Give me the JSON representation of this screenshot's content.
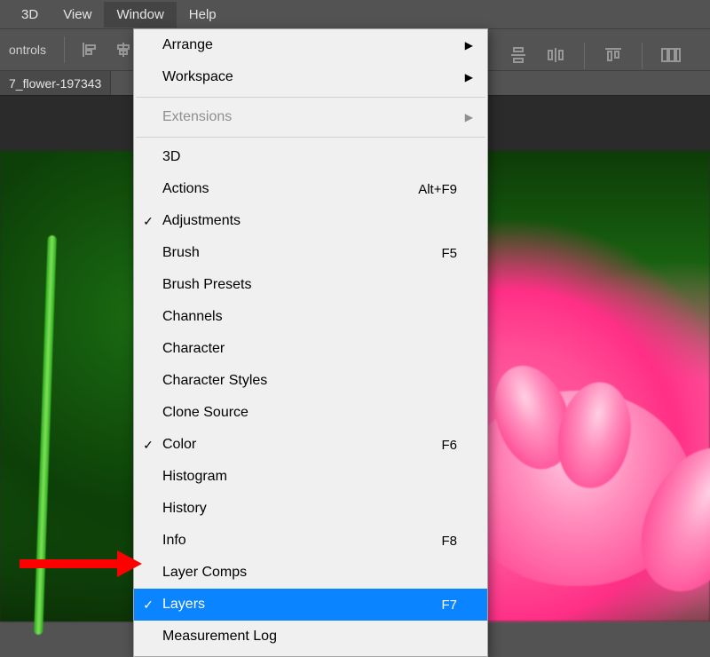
{
  "menubar": {
    "items": [
      "3D",
      "View",
      "Window",
      "Help"
    ],
    "active_index": 2
  },
  "toolbar": {
    "controls_label": "ontrols"
  },
  "doc_tab": {
    "label": "7_flower-197343"
  },
  "dropdown": {
    "items": [
      {
        "label": "Arrange",
        "submenu": true
      },
      {
        "label": "Workspace",
        "submenu": true
      },
      {
        "separator": true
      },
      {
        "label": "Extensions",
        "submenu": true,
        "disabled": true
      },
      {
        "separator": true
      },
      {
        "label": "3D"
      },
      {
        "label": "Actions",
        "shortcut": "Alt+F9"
      },
      {
        "label": "Adjustments",
        "checked": true
      },
      {
        "label": "Brush",
        "shortcut": "F5"
      },
      {
        "label": "Brush Presets"
      },
      {
        "label": "Channels"
      },
      {
        "label": "Character"
      },
      {
        "label": "Character Styles"
      },
      {
        "label": "Clone Source"
      },
      {
        "label": "Color",
        "shortcut": "F6",
        "checked": true
      },
      {
        "label": "Histogram"
      },
      {
        "label": "History"
      },
      {
        "label": "Info",
        "shortcut": "F8"
      },
      {
        "label": "Layer Comps"
      },
      {
        "label": "Layers",
        "shortcut": "F7",
        "checked": true,
        "highlight": true
      },
      {
        "label": "Measurement Log"
      }
    ]
  },
  "colors": {
    "highlight": "#0a84ff",
    "annotation": "#ff0000"
  }
}
